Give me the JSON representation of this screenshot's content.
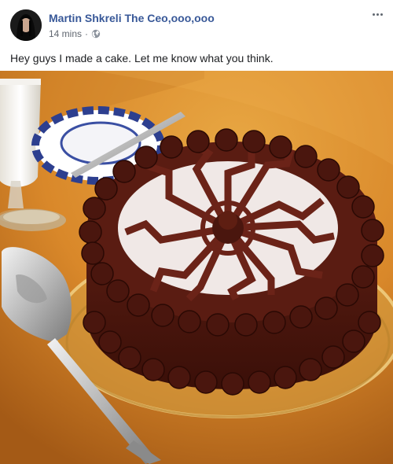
{
  "post": {
    "author_name": "Martin Shkreli The Ceo,ooo,ooo",
    "timestamp": "14 mins",
    "separator": "·",
    "privacy_icon": "globe-icon",
    "more_icon": "more-options-icon",
    "text": "Hey guys I made a cake. Let me know what you think."
  },
  "colors": {
    "author_link": "#385898",
    "meta_text": "#606770",
    "tablecloth": "#d98a2a",
    "frosting": "#4a160e",
    "stencil": "#f0e8e6"
  }
}
